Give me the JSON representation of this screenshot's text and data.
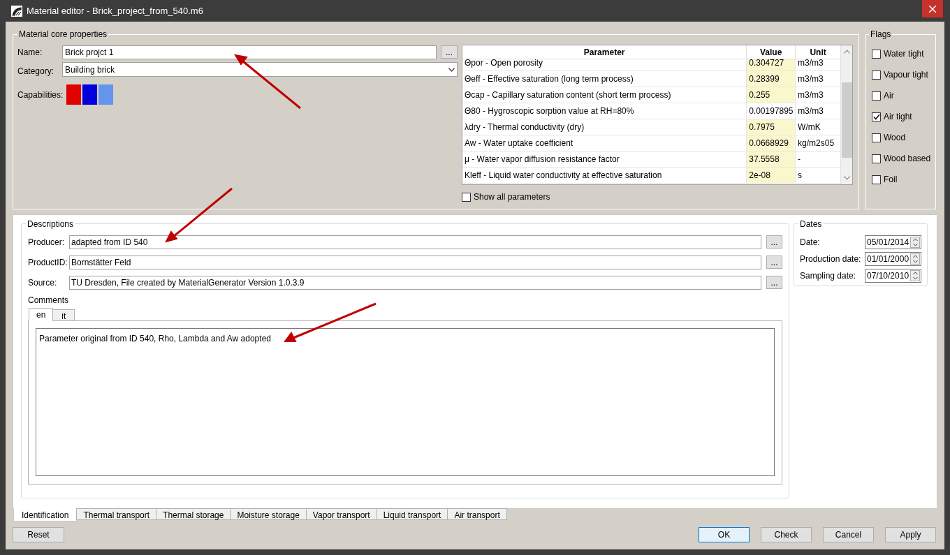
{
  "window": {
    "title": "Material editor - Brick_project_from_540.m6"
  },
  "core": {
    "title": "Material core properties",
    "name_label": "Name:",
    "name_value": "Brick projct 1",
    "browse": "...",
    "category_label": "Category:",
    "category_value": "Building brick",
    "capabilities_label": "Capabilities:",
    "capabilities": [
      {
        "color": "#e00000"
      },
      {
        "color": "#0000dd"
      },
      {
        "color": "#6495ed"
      }
    ]
  },
  "parameters": {
    "columns": [
      "Parameter",
      "Value",
      "Unit"
    ],
    "rows": [
      {
        "parameter": "Θpor - Open porosity",
        "value": "0.304727",
        "unit": "m3/m3",
        "highlighted": true
      },
      {
        "parameter": "Θeff - Effective saturation (long term process)",
        "value": "0.28399",
        "unit": "m3/m3",
        "highlighted": true
      },
      {
        "parameter": "Θcap - Capillary saturation content (short term process)",
        "value": "0.255",
        "unit": "m3/m3",
        "highlighted": true
      },
      {
        "parameter": "Θ80 - Hygroscopic sorption value at RH=80%",
        "value": "0.00197895",
        "unit": "m3/m3",
        "highlighted": false
      },
      {
        "parameter": "λdry - Thermal conductivity (dry)",
        "value": "0.7975",
        "unit": "W/mK",
        "highlighted": true
      },
      {
        "parameter": "Aw - Water uptake coefficient",
        "value": "0.0668929",
        "unit": "kg/m2s05",
        "highlighted": true
      },
      {
        "parameter": "μ - Water vapor diffusion resistance factor",
        "value": "37.5558",
        "unit": "-",
        "highlighted": true
      },
      {
        "parameter": "Kleff - Liquid water conductivity at effective saturation",
        "value": "2e-08",
        "unit": "s",
        "highlighted": true
      }
    ],
    "show_all": {
      "label": "Show all parameters",
      "checked": false
    }
  },
  "flags": {
    "title": "Flags",
    "items": [
      {
        "label": "Water tight",
        "checked": false
      },
      {
        "label": "Vapour tight",
        "checked": false
      },
      {
        "label": "Air",
        "checked": false
      },
      {
        "label": "Air tight",
        "checked": true
      },
      {
        "label": "Wood",
        "checked": false
      },
      {
        "label": "Wood based",
        "checked": false
      },
      {
        "label": "Foil",
        "checked": false
      }
    ]
  },
  "descriptions": {
    "title": "Descriptions",
    "fields": [
      {
        "label": "Producer:",
        "value": "adapted from ID 540"
      },
      {
        "label": "ProductID:",
        "value": "Bornstätter Feld"
      },
      {
        "label": "Source:",
        "value": "TU Dresden, File created by MaterialGenerator Version 1.0.3.9"
      }
    ],
    "browse": "...",
    "comments_label": "Comments",
    "comment_tabs": [
      {
        "label": "en",
        "selected": true
      },
      {
        "label": "it",
        "selected": false
      }
    ],
    "comment_text": "Parameter original from ID 540, Rho, Lambda and Aw adopted"
  },
  "dates": {
    "title": "Dates",
    "fields": [
      {
        "label": "Date:",
        "value": "05/01/2014"
      },
      {
        "label": "Production date:",
        "value": "01/01/2000"
      },
      {
        "label": "Sampling date:",
        "value": "07/10/2010"
      }
    ]
  },
  "tabs": [
    {
      "label": "Identification",
      "selected": true
    },
    {
      "label": "Thermal transport",
      "selected": false
    },
    {
      "label": "Thermal storage",
      "selected": false
    },
    {
      "label": "Moisture storage",
      "selected": false
    },
    {
      "label": "Vapor transport",
      "selected": false
    },
    {
      "label": "Liquid transport",
      "selected": false
    },
    {
      "label": "Air transport",
      "selected": false
    }
  ],
  "buttons": {
    "reset": "Reset",
    "right": [
      {
        "label": "OK",
        "selected": true
      },
      {
        "label": "Check",
        "selected": false
      },
      {
        "label": "Cancel",
        "selected": false
      },
      {
        "label": "Apply",
        "selected": false
      }
    ]
  }
}
